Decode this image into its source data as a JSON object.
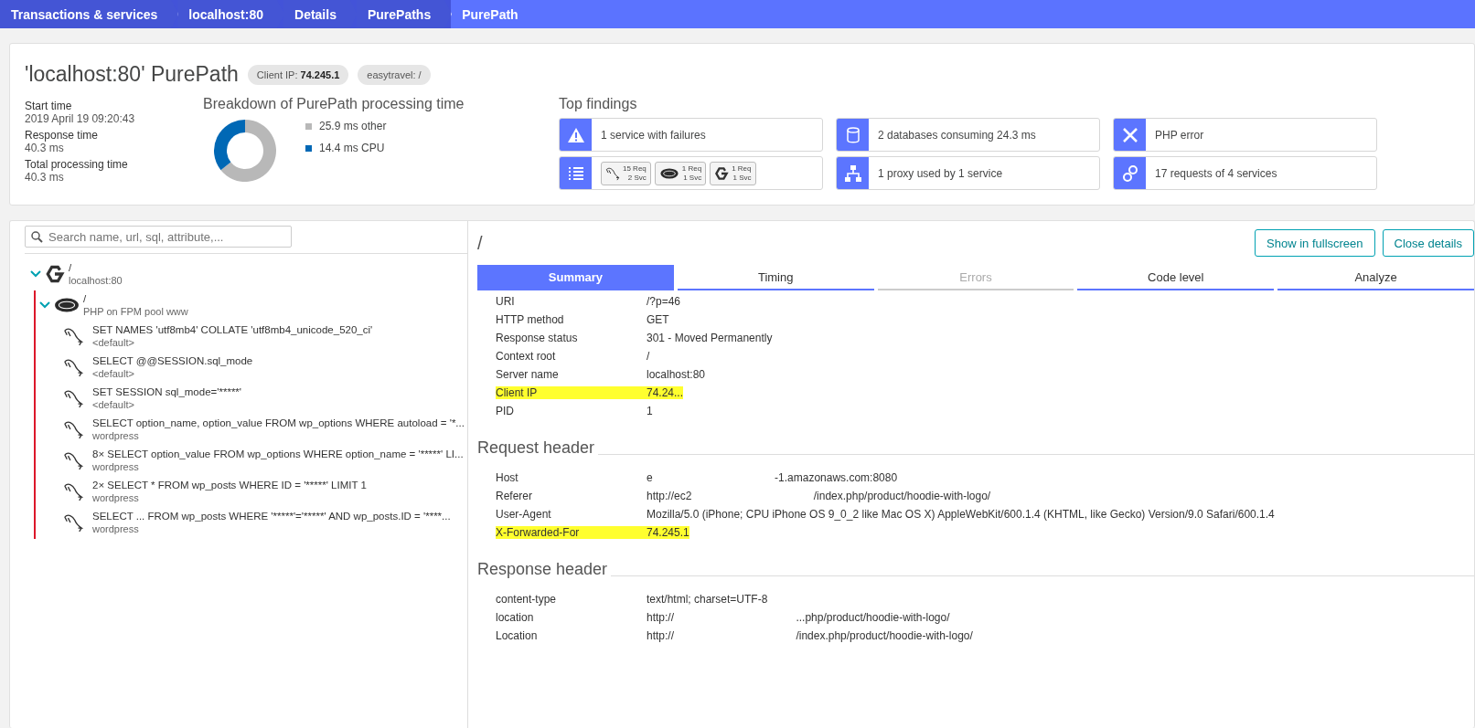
{
  "breadcrumbs": [
    {
      "label": "Transactions & services",
      "selected": false
    },
    {
      "label": "localhost:80",
      "selected": false
    },
    {
      "label": "Details",
      "selected": false
    },
    {
      "label": "PurePaths",
      "selected": false
    },
    {
      "label": "PurePath",
      "selected": true
    }
  ],
  "header": {
    "title": "'localhost:80' PurePath",
    "chips": [
      "Client IP: **74.245.1**",
      "easytravel: /"
    ]
  },
  "stats": [
    {
      "label": "Start time",
      "value": "2019 April 19 09:20:43"
    },
    {
      "label": "Response time",
      "value": "40.3 ms"
    },
    {
      "label": "Total processing time",
      "value": "40.3 ms"
    }
  ],
  "breakdown": {
    "title": "Breakdown of PurePath processing time",
    "chart_data": {
      "type": "donut",
      "categories": [
        "25.9 ms other",
        "14.4 ms CPU"
      ],
      "values": [
        25.9,
        14.4
      ],
      "legend": "right"
    }
  },
  "findings": {
    "title": "Top findings",
    "items": [
      {
        "kind": "failure",
        "label": "1 service with failures"
      },
      {
        "kind": "database",
        "label": "2 databases consuming 24.3 ms"
      },
      {
        "kind": "error",
        "label": "PHP error"
      },
      {
        "kind": "services",
        "services": [
          {
            "kind": "database",
            "requests": "15 Req",
            "count": "2 Svc"
          },
          {
            "kind": "php",
            "requests": "1 Req",
            "count": "1 Svc"
          },
          {
            "kind": "webserver",
            "requests": "1 Req",
            "count": "1 Svc"
          }
        ]
      },
      {
        "kind": "proxy",
        "label": "1 proxy used by 1 service"
      },
      {
        "kind": "requests",
        "label": "17 requests of 4 services"
      }
    ]
  },
  "search": {
    "placeholder": "Search name, url, sql, attribute,..."
  },
  "tree": [
    {
      "kind": "webserver",
      "title": "/",
      "subtitle": "localhost:80",
      "expanded": true,
      "failed": false,
      "children": [
        {
          "kind": "php",
          "title": "/",
          "subtitle": "PHP on FPM pool www",
          "expanded": true,
          "failed": true,
          "children": [
            {
              "kind": "database",
              "title": "SET NAMES 'utf8mb4' COLLATE 'utf8mb4_unicode_520_ci'",
              "subtitle": "<default>"
            },
            {
              "kind": "database",
              "title": "SELECT @@SESSION.sql_mode",
              "subtitle": "<default>"
            },
            {
              "kind": "database",
              "title": "SET SESSION sql_mode='*****'",
              "subtitle": "<default>"
            },
            {
              "kind": "database",
              "title": "SELECT option_name, option_value FROM wp_options WHERE autoload = '*...",
              "subtitle": "wordpress"
            },
            {
              "kind": "database",
              "title": "8× SELECT option_value FROM wp_options WHERE option_name = '*****' LI...",
              "subtitle": "wordpress"
            },
            {
              "kind": "database",
              "title": "2× SELECT * FROM wp_posts WHERE ID = '*****' LIMIT 1",
              "subtitle": "wordpress"
            },
            {
              "kind": "database",
              "title": "SELECT ... FROM wp_posts WHERE '*****'='*****' AND wp_posts.ID = '****...",
              "subtitle": "wordpress"
            }
          ]
        }
      ]
    }
  ],
  "detail": {
    "title": "/",
    "buttons": [
      "Show in fullscreen",
      "Close details"
    ],
    "tabs": [
      {
        "label": "Summary",
        "selected": true,
        "disabled": false
      },
      {
        "label": "Timing",
        "selected": false,
        "disabled": false
      },
      {
        "label": "Errors",
        "selected": false,
        "disabled": true
      },
      {
        "label": "Code level",
        "selected": false,
        "disabled": false
      },
      {
        "label": "Analyze",
        "selected": false,
        "disabled": false
      }
    ],
    "rows": [
      {
        "label": "URI",
        "value": "/?p=46",
        "highlighted": false
      },
      {
        "label": "HTTP method",
        "value": "GET",
        "highlighted": false
      },
      {
        "label": "Response status",
        "value": "301 - Moved Permanently",
        "highlighted": false
      },
      {
        "label": "Context root",
        "value": "/",
        "highlighted": false
      },
      {
        "label": "Server name",
        "value": "localhost:80",
        "highlighted": false
      },
      {
        "label": "Client IP",
        "value": "74.24...",
        "highlighted": true
      },
      {
        "label": "PID",
        "value": "1",
        "highlighted": false
      }
    ],
    "sections": [
      {
        "title": "Request header",
        "rows": [
          {
            "label": "Host",
            "value": "e                                        -1.amazonaws.com:8080",
            "highlighted": false
          },
          {
            "label": "Referer",
            "value": "http://ec2                                        /index.php/product/hoodie-with-logo/",
            "highlighted": false
          },
          {
            "label": "User-Agent",
            "value": "Mozilla/5.0 (iPhone; CPU iPhone OS 9_0_2 like Mac OS X) AppleWebKit/600.1.4 (KHTML, like Gecko) Version/9.0 Safari/600.1.4",
            "highlighted": false
          },
          {
            "label": "X-Forwarded-For",
            "value": "74.245.1",
            "highlighted": true
          }
        ]
      },
      {
        "title": "Response header",
        "rows": [
          {
            "label": "content-type",
            "value": "text/html; charset=UTF-8",
            "highlighted": false
          },
          {
            "label": "location",
            "value": "http://                                        ...php/product/hoodie-with-logo/",
            "highlighted": false
          },
          {
            "label": "Location",
            "value": "http://                                        /index.php/product/hoodie-with-logo/",
            "highlighted": false
          }
        ]
      }
    ]
  }
}
